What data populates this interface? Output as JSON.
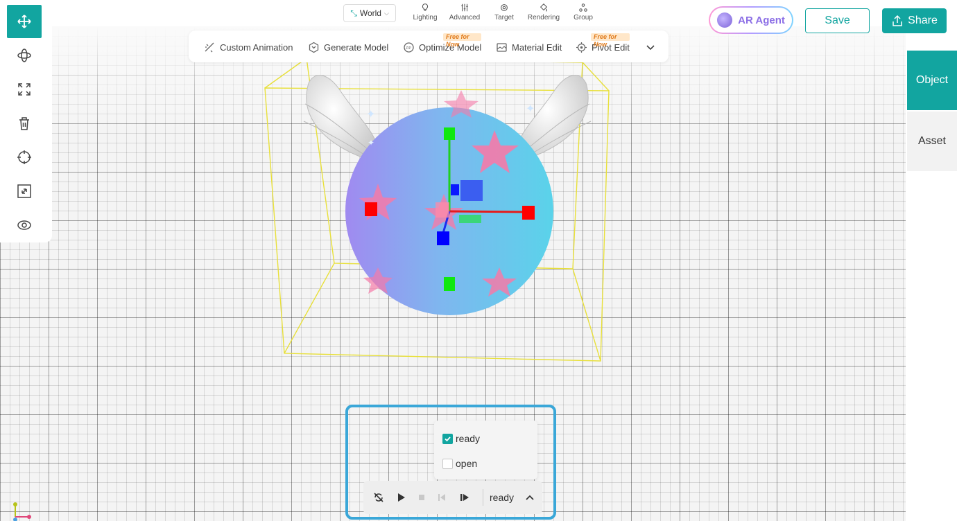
{
  "header": {
    "space_select": "World",
    "tools": [
      "Lighting",
      "Advanced",
      "Target",
      "Rendering",
      "Group"
    ],
    "ar_agent_label": "AR Agent",
    "save_label": "Save",
    "share_label": "Share"
  },
  "feature_bar": {
    "items": [
      {
        "label": "Custom Animation",
        "icon": "custom-animation-icon"
      },
      {
        "label": "Generate Model",
        "icon": "generate-model-icon"
      },
      {
        "label": "Optimize Model",
        "icon": "optimize-model-icon",
        "badge": "Free for Now"
      },
      {
        "label": "Material Edit",
        "icon": "material-edit-icon"
      },
      {
        "label": "Pivot Edit",
        "icon": "pivot-edit-icon",
        "badge": "Free for Now"
      }
    ]
  },
  "left_toolbar": {
    "items": [
      "move-icon",
      "rotate-icon",
      "scale-icon",
      "delete-icon",
      "focus-icon",
      "fit-icon",
      "visibility-icon"
    ]
  },
  "right_panel": {
    "tabs": [
      "Object",
      "Asset"
    ]
  },
  "animation": {
    "options": [
      {
        "label": "ready",
        "checked": true
      },
      {
        "label": "open",
        "checked": false
      }
    ],
    "current": "ready"
  },
  "colors": {
    "accent": "#12a5a0",
    "highlight": "#3aa7d8",
    "badge_text": "#e07a1a"
  }
}
